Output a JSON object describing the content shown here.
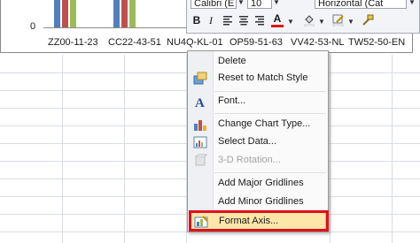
{
  "chart": {
    "y_tick": "0",
    "categories": [
      "ZZ00-11-23",
      "CC22-43-51",
      "NU4Q-KL-01",
      "OP59-51-63",
      "VV42-53-NL",
      "TW52-50-EN"
    ],
    "series_colors": [
      "#4f81bd",
      "#c0504d",
      "#9bbb59"
    ]
  },
  "mini_toolbar": {
    "font_name": "Calibri (E",
    "font_size": "10",
    "chart_element": "Horizontal (Cat",
    "bold_label": "B",
    "italic_label": "I",
    "font_color_label": "A",
    "font_color": "#e0101a"
  },
  "context_menu": {
    "items": [
      {
        "label": "Delete",
        "icon": "",
        "disabled": false
      },
      {
        "label": "Reset to Match Style",
        "icon": "reset-style-icon",
        "disabled": false
      },
      {
        "label": "Font...",
        "icon": "font-icon",
        "disabled": false
      },
      {
        "label": "Change Chart Type...",
        "icon": "chart-type-icon",
        "disabled": false
      },
      {
        "label": "Select Data...",
        "icon": "select-data-icon",
        "disabled": false
      },
      {
        "label": "3-D Rotation...",
        "icon": "rotation-icon",
        "disabled": true
      },
      {
        "label": "Add Major Gridlines",
        "icon": "",
        "disabled": false
      },
      {
        "label": "Add Minor Gridlines",
        "icon": "",
        "disabled": false
      },
      {
        "label": "Format Axis...",
        "icon": "format-axis-icon",
        "disabled": false
      }
    ],
    "highlighted": "Format Axis..."
  }
}
